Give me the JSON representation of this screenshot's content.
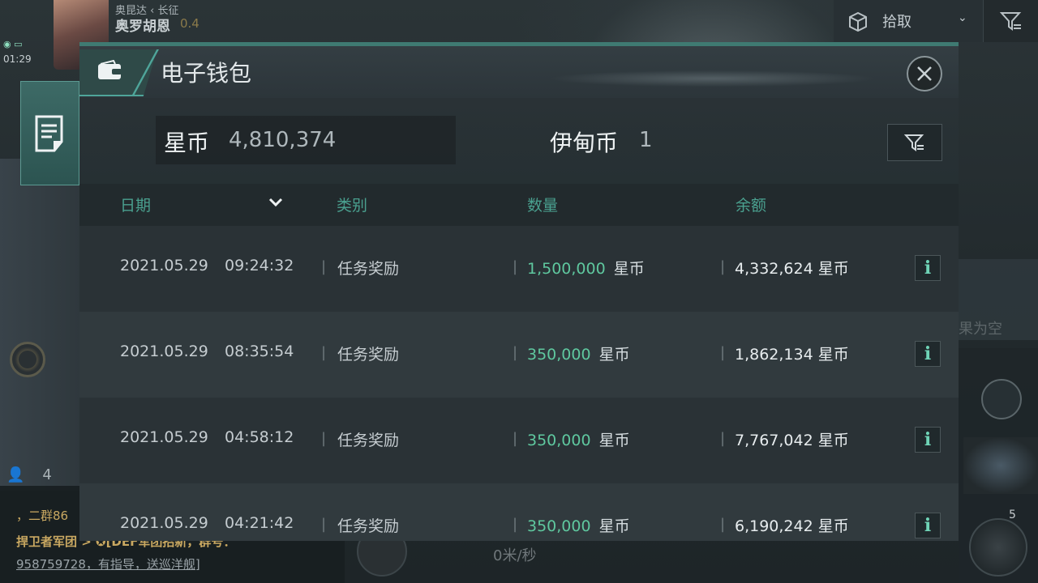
{
  "hud": {
    "player_tag": "奥昆达 ‹ 长征",
    "player_name": "奥罗胡恩",
    "player_stat": "0.4",
    "clock": "01:29",
    "people_count": "4",
    "chat_line1": "，二群86",
    "chat_line2": "捍卫者军团 > ✪[DEF军团招新，群号：",
    "chat_line3": "958759728，有指导，送巡洋舰]",
    "speed": "0米/秒",
    "ghost_text": "果为空",
    "slot_badge": "5",
    "pickup_label": "拾取"
  },
  "dialog": {
    "title": "电子钱包",
    "balances": [
      {
        "label": "星币",
        "value": "4,810,374"
      },
      {
        "label": "伊甸币",
        "value": "1"
      }
    ],
    "columns": {
      "date": "日期",
      "category": "类别",
      "quantity": "数量",
      "balance": "余额"
    },
    "rows": [
      {
        "date": "2021.05.29",
        "time": "09:24:32",
        "category": "任务奖励",
        "amount": "1,500,000",
        "amount_unit": "星币",
        "balance": "4,332,624",
        "balance_unit": "星币"
      },
      {
        "date": "2021.05.29",
        "time": "08:35:54",
        "category": "任务奖励",
        "amount": "350,000",
        "amount_unit": "星币",
        "balance": "1,862,134",
        "balance_unit": "星币"
      },
      {
        "date": "2021.05.29",
        "time": "04:58:12",
        "category": "任务奖励",
        "amount": "350,000",
        "amount_unit": "星币",
        "balance": "7,767,042",
        "balance_unit": "星币"
      },
      {
        "date": "2021.05.29",
        "time": "04:21:42",
        "category": "任务奖励",
        "amount": "350,000",
        "amount_unit": "星币",
        "balance": "6,190,242",
        "balance_unit": "星币"
      }
    ],
    "info_glyph": "i",
    "accent_color": "#4fa59a",
    "amount_color": "#5fc89f"
  }
}
